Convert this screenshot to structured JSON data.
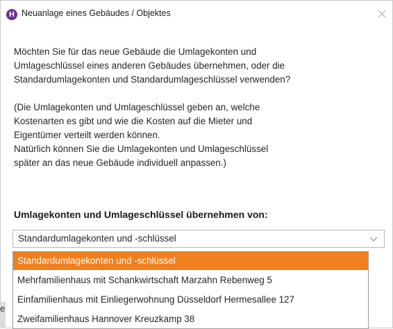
{
  "dialog": {
    "title": "Neuanlage eines Gebäudes / Objektes",
    "app_icon_letter": "H",
    "close_icon": "close-icon"
  },
  "message": {
    "p1_l1": "Möchten Sie für das neue Gebäude die Umlagekonten und",
    "p1_l2": "Umlageschlüssel eines anderen Gebäudes übernehmen, oder die",
    "p1_l3": "Standardumlagekonten und Standardumlageschlüssel verwenden?",
    "p2_l1": "(Die Umlagekonten und Umlageschlüssel geben an, welche",
    "p2_l2": "Kostenarten es gibt und wie die Kosten auf die Mieter und",
    "p2_l3": "Eigentümer verteilt werden können.",
    "p2_l4": "Natürlich können Sie die Umlagekonten und Umlageschlüssel",
    "p2_l5": "später an das neue Gebäude individuell anpassen.)"
  },
  "section_label": "Umlagekonten und Umlageschlüssel übernehmen von:",
  "combo": {
    "value": "Standardumlagekonten und -schlüssel",
    "chevron_icon": "chevron-down-icon"
  },
  "dropdown": {
    "options": [
      {
        "label": "Standardumlagekonten und -schlüssel",
        "selected": true
      },
      {
        "label": "Mehrfamilienhaus mit Schankwirtschaft Marzahn Rebenweg 5",
        "selected": false
      },
      {
        "label": "Einfamilienhaus mit Einliegerwohnung Düsseldorf Hermesallee 127",
        "selected": false
      },
      {
        "label": "Zweifamilienhaus Hannover Kreuzkamp 38",
        "selected": false
      }
    ]
  },
  "background_fragment": "e",
  "colors": {
    "accent": "#f07f1e",
    "app_icon": "#6b2e8c"
  }
}
